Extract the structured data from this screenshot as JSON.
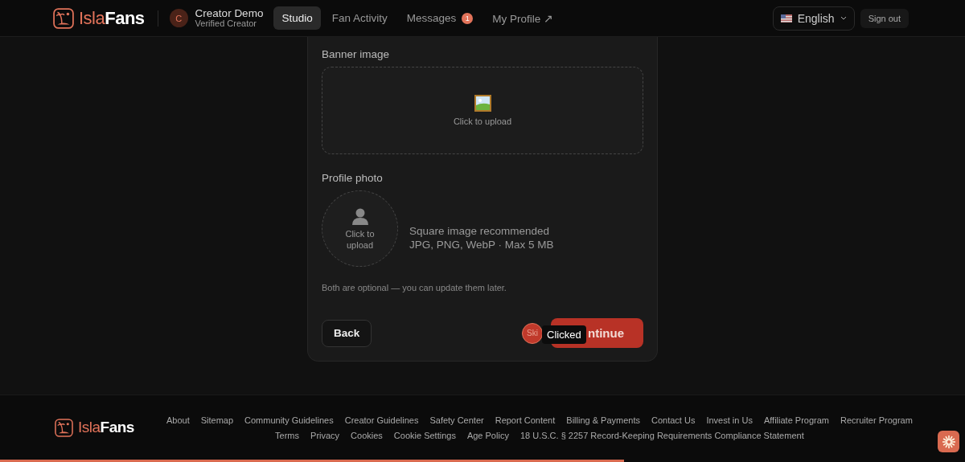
{
  "header": {
    "logo": {
      "part_1": "Isla",
      "part_2": "Fans"
    },
    "user": {
      "initial": "C",
      "name": "Creator Demo",
      "role": "Verified Creator"
    },
    "nav": [
      {
        "label": "Studio",
        "selected": true
      },
      {
        "label": "Fan Activity",
        "selected": false
      },
      {
        "label": "Messages",
        "selected": false,
        "badge": "1"
      },
      {
        "label": "My Profile ↗",
        "selected": false
      }
    ],
    "language": "English",
    "sign_out": "Sign out"
  },
  "form": {
    "banner": {
      "label": "Banner image",
      "hint": "Click to upload"
    },
    "photo": {
      "label": "Profile photo",
      "hint": "Click to upload",
      "notes": [
        "Square image recommended",
        "JPG, PNG, WebP · Max 5 MB"
      ]
    },
    "note": "Both are optional — you can update them later.",
    "back": "Back",
    "skip": "Ski",
    "continue": "ntinue",
    "tooltip": "Clicked"
  },
  "footer": {
    "logo": {
      "part_1": "Isla",
      "part_2": "Fans"
    },
    "links_row_1": [
      "About",
      "Sitemap",
      "Community Guidelines",
      "Creator Guidelines",
      "Safety Center",
      "Report Content",
      "Billing & Payments",
      "Contact Us",
      "Invest in Us",
      "Affiliate Program",
      "Recruiter Program"
    ],
    "links_row_2": [
      "Terms",
      "Privacy",
      "Cookies",
      "Cookie Settings",
      "Age Policy",
      "18 U.S.C. § 2257 Record-Keeping Requirements Compliance Statement"
    ]
  },
  "progress": {
    "level": 0.647
  }
}
